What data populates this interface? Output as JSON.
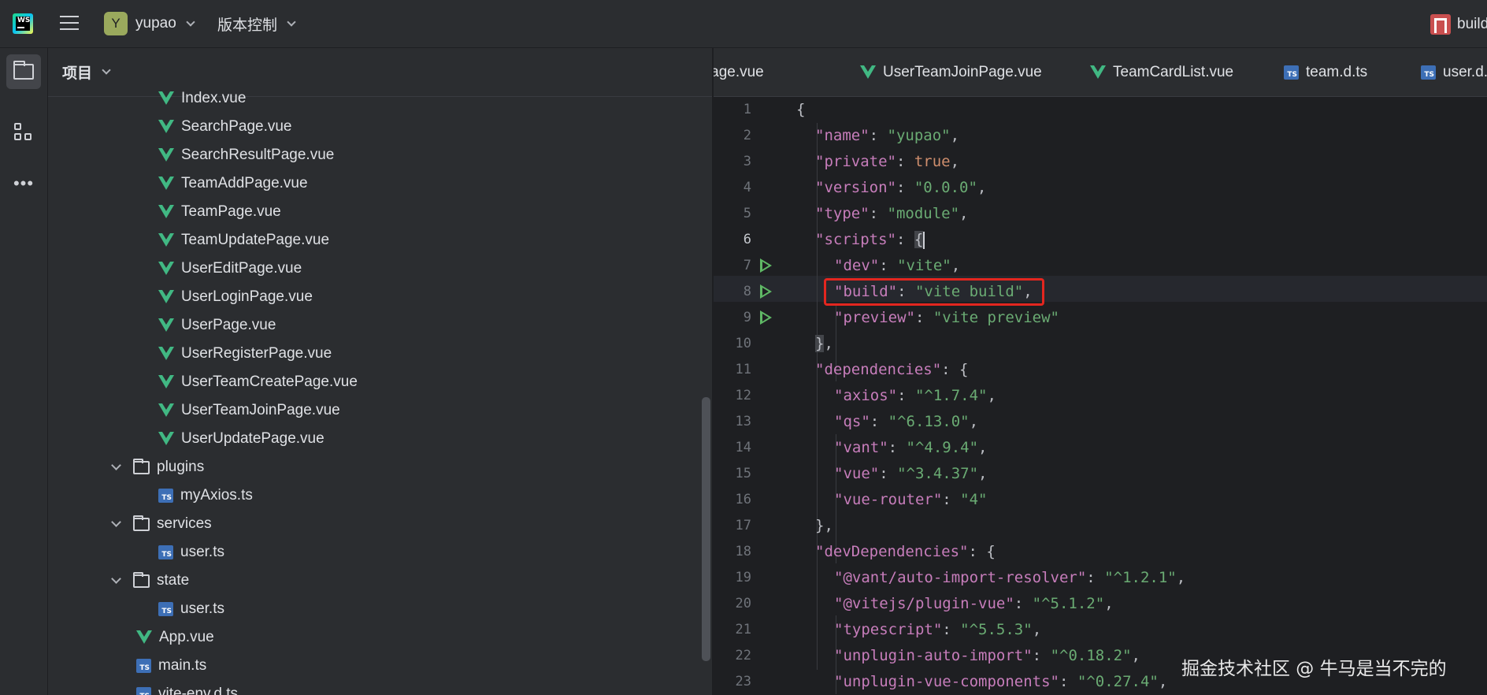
{
  "titlebar": {
    "project_initial": "Y",
    "project_name": "yupao",
    "vcs_label": "版本控制",
    "run_config_label": "build"
  },
  "activitybar": {
    "icons": [
      "project-folder-icon",
      "structure-icon",
      "more-icon"
    ]
  },
  "project_panel": {
    "title": "项目",
    "tree": [
      {
        "label": "Index.vue",
        "type": "vue"
      },
      {
        "label": "SearchPage.vue",
        "type": "vue"
      },
      {
        "label": "SearchResultPage.vue",
        "type": "vue"
      },
      {
        "label": "TeamAddPage.vue",
        "type": "vue"
      },
      {
        "label": "TeamPage.vue",
        "type": "vue"
      },
      {
        "label": "TeamUpdatePage.vue",
        "type": "vue"
      },
      {
        "label": "UserEditPage.vue",
        "type": "vue"
      },
      {
        "label": "UserLoginPage.vue",
        "type": "vue"
      },
      {
        "label": "UserPage.vue",
        "type": "vue"
      },
      {
        "label": "UserRegisterPage.vue",
        "type": "vue"
      },
      {
        "label": "UserTeamCreatePage.vue",
        "type": "vue"
      },
      {
        "label": "UserTeamJoinPage.vue",
        "type": "vue"
      },
      {
        "label": "UserUpdatePage.vue",
        "type": "vue"
      },
      {
        "label": "plugins",
        "type": "folder"
      },
      {
        "label": "myAxios.ts",
        "type": "ts"
      },
      {
        "label": "services",
        "type": "folder"
      },
      {
        "label": "user.ts",
        "type": "ts"
      },
      {
        "label": "state",
        "type": "folder"
      },
      {
        "label": "user.ts",
        "type": "ts"
      },
      {
        "label": "App.vue",
        "type": "vue"
      },
      {
        "label": "main.ts",
        "type": "ts"
      },
      {
        "label": "vite-env.d.ts",
        "type": "ts"
      }
    ]
  },
  "editor": {
    "tabs": [
      {
        "label": "TeamPage.vue",
        "type": "vue"
      },
      {
        "label": "UserTeamJoinPage.vue",
        "type": "vue"
      },
      {
        "label": "TeamCardList.vue",
        "type": "vue"
      },
      {
        "label": "team.d.ts",
        "type": "ts"
      },
      {
        "label": "user.d.ts",
        "type": "ts"
      }
    ],
    "ts_badge": "TS",
    "line_numbers": [
      "1",
      "2",
      "3",
      "4",
      "5",
      "6",
      "7",
      "8",
      "9",
      "10",
      "11",
      "12",
      "13",
      "14",
      "15",
      "16",
      "17",
      "18",
      "19",
      "20",
      "21",
      "22",
      "23"
    ],
    "current_line": 6,
    "run_lines": [
      7,
      8,
      9
    ],
    "highlighted_line": 8
  },
  "watermark": "掘金技术社区 @ 牛马是当不完的"
}
